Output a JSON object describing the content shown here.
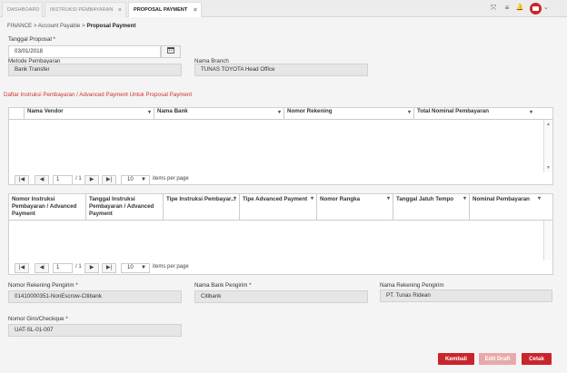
{
  "tabs": [
    {
      "label": "DASHBOARD"
    },
    {
      "label": "INSTRUKSI PEMBAYARAN",
      "close": "×"
    },
    {
      "label": "PROPOSAL PAYMENT",
      "close": "×"
    }
  ],
  "toolbar": {
    "expand_icon": "⤧",
    "menu_icon": "≡",
    "bell_icon": "🔔",
    "chevron": "⌄"
  },
  "breadcrumb": {
    "part1": "FINANCE",
    "sep": ">",
    "part2": "Account Payable",
    "part3": "Proposal Payment"
  },
  "form": {
    "tanggal_label": "Tanggal Proposal *",
    "tanggal_value": "03/01/2018",
    "calendar_icon": "📅",
    "metode_label": "Metode Pembayaran",
    "metode_value": "Bank Transfer",
    "branch_label": "Nama Branch",
    "branch_value": "TUNAS TOYOTA Head Office"
  },
  "section_title": "Daftar Instruksi Pembayaran / Advanced Payment Untuk Proposal Payment",
  "grid1": {
    "columns": [
      "Nama Vendor",
      "Nama Bank",
      "Nomor Rekening",
      "Total Nominal Pembayaran"
    ],
    "caret": "▾"
  },
  "grid2": {
    "columns": [
      "Nomor Instruksi Pembayaran / Advanced Payment",
      "Tanggal Instruksi Pembayaran / Advanced Payment",
      "Tipe Instruksi Pembayar...",
      "Tipe Advanced Payment",
      "Nomor Rangka",
      "Tanggal Jatuh Tempo",
      "Nominal Pembayaran"
    ],
    "caret": "▾"
  },
  "pager": {
    "first": "|◀",
    "prev": "◀",
    "page": "1",
    "of": "/ 1",
    "next": "▶",
    "last": "▶|",
    "page_size": "10",
    "per_page_label": "items per page"
  },
  "footer_form": {
    "rek_label": "Nomor Rekening Pengirim *",
    "rek_value": "01410000351-NonEscrow-Citibank",
    "bank_label": "Nama Bank Pengirim *",
    "bank_value": "Citibank",
    "namarek_label": "Nama Rekening Pengirim",
    "namarek_value": "PT. Tunas Ridean",
    "giro_label": "Nomor Giro/Checkque *",
    "giro_value": "UAT-SL-01-007"
  },
  "buttons": {
    "kembali": "Kembali",
    "edit_draft": "Edit Draft",
    "cetak": "Cetak"
  },
  "colors": {
    "accent": "#c9252b",
    "section_title": "#d0322d",
    "disabled": "#e8a9aa"
  }
}
